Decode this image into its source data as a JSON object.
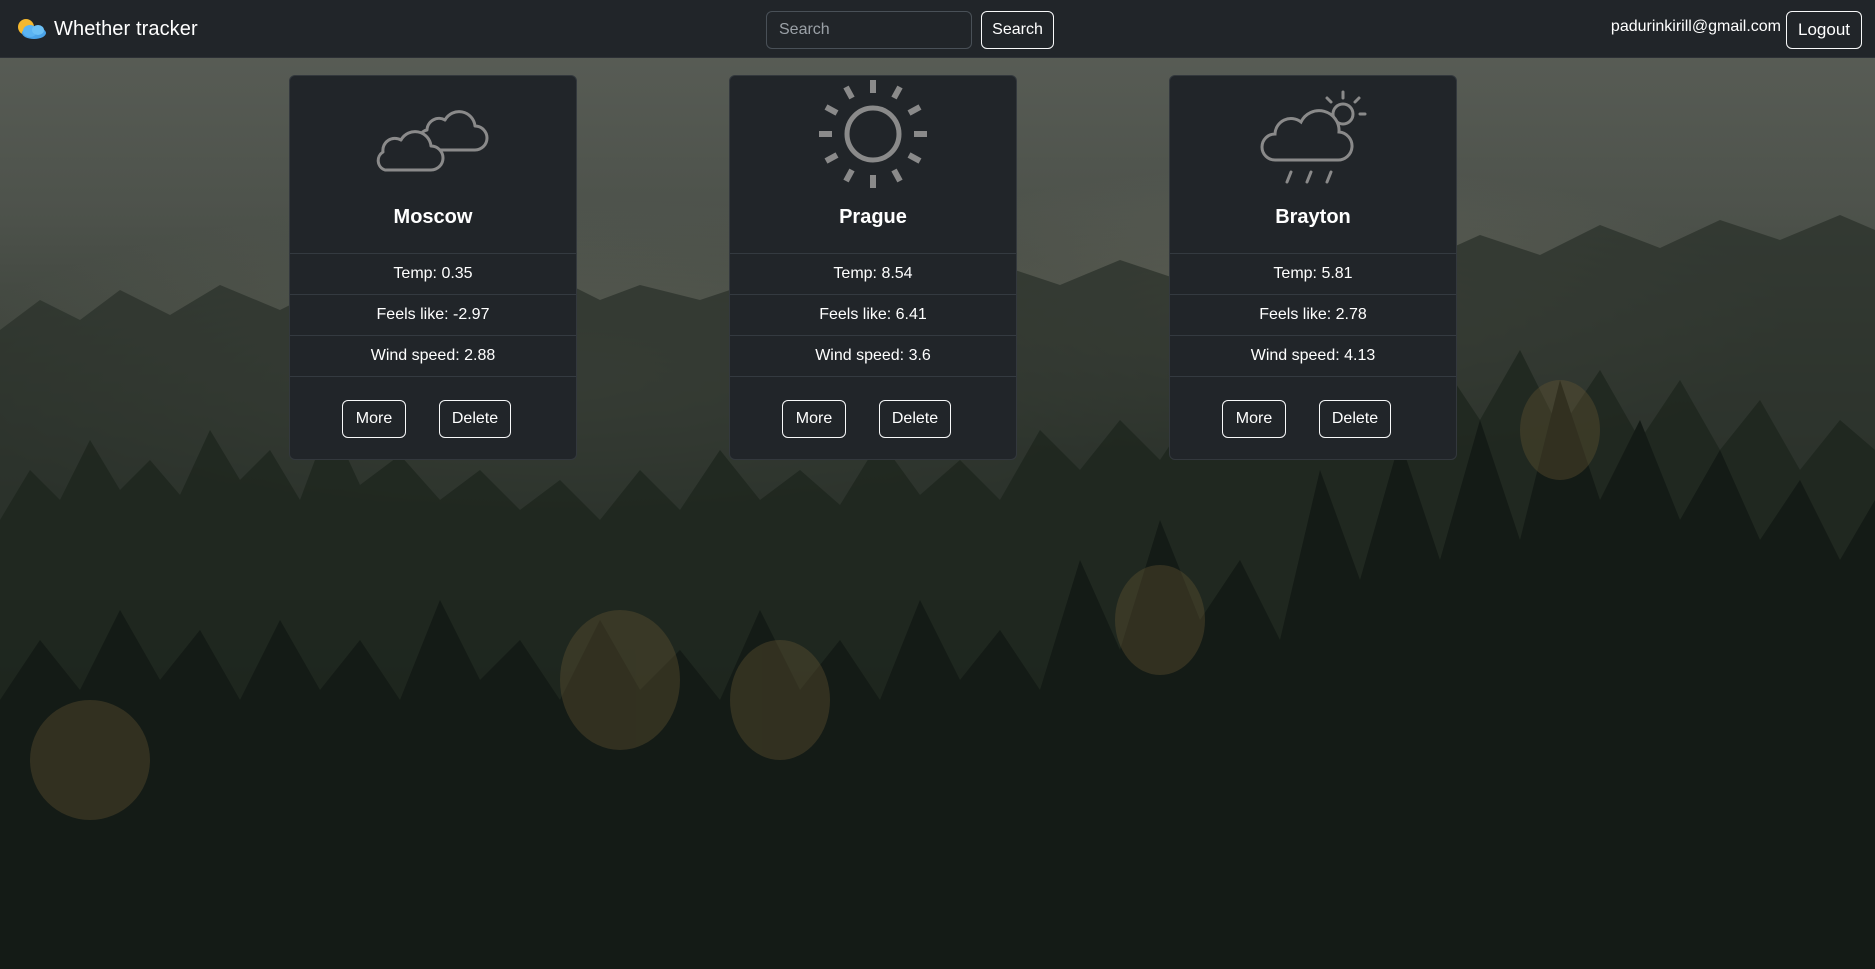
{
  "navbar": {
    "brand_icon": "sun-cloud-icon",
    "brand_title": "Whether tracker",
    "search_placeholder": "Search",
    "search_button": "Search",
    "user_email": "padurinkirill@gmail.com",
    "logout_button": "Logout"
  },
  "cards": [
    {
      "icon": "cloudy-icon",
      "city": "Moscow",
      "temp": "Temp: 0.35",
      "feels_like": "Feels like: -2.97",
      "wind_speed": "Wind speed: 2.88",
      "more_button": "More",
      "delete_button": "Delete"
    },
    {
      "icon": "sunny-icon",
      "city": "Prague",
      "temp": "Temp: 8.54",
      "feels_like": "Feels like: 6.41",
      "wind_speed": "Wind speed: 3.6",
      "more_button": "More",
      "delete_button": "Delete"
    },
    {
      "icon": "rain-sun-cloud-icon",
      "city": "Brayton",
      "temp": "Temp: 5.81",
      "feels_like": "Feels like: 2.78",
      "wind_speed": "Wind speed: 4.13",
      "more_button": "More",
      "delete_button": "Delete"
    }
  ],
  "colors": {
    "navbar_bg": "#212529",
    "card_bg": "#212529",
    "icon_gray": "#8a8a8a",
    "text": "#ffffff"
  }
}
